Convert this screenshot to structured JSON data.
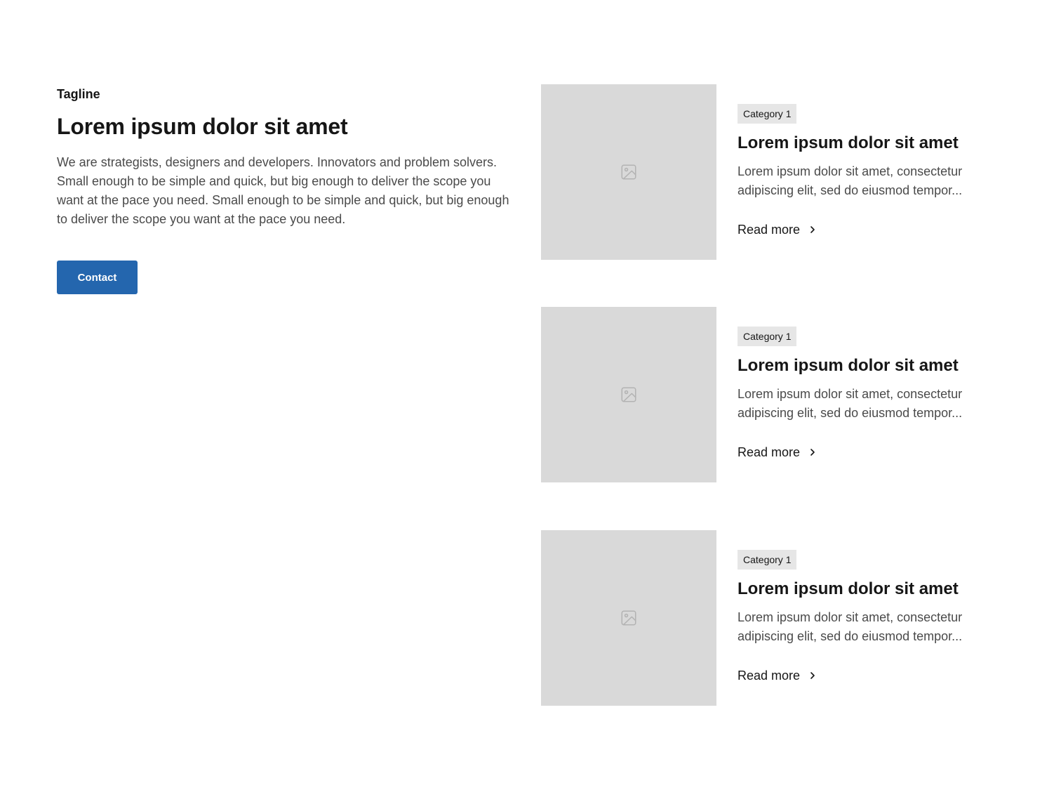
{
  "intro": {
    "tagline": "Tagline",
    "headline": "Lorem ipsum dolor sit amet",
    "description": "We are strategists, designers and developers. Innovators and problem solvers. Small enough to be simple and quick, but big enough to deliver the scope you want at the pace you need. Small enough to be simple and quick, but big enough to deliver the scope you want at the pace you need.",
    "contact_label": "Contact"
  },
  "cards": [
    {
      "category": "Category 1",
      "title": "Lorem ipsum dolor sit amet",
      "excerpt_line1": "Lorem ipsum dolor sit amet, consectetur",
      "excerpt_line2": "adipiscing elit, sed do eiusmod tempor...",
      "read_more": "Read more",
      "image_icon": "image-placeholder-icon"
    },
    {
      "category": "Category 1",
      "title": "Lorem ipsum dolor sit amet",
      "excerpt_line1": "Lorem ipsum dolor sit amet, consectetur",
      "excerpt_line2": "adipiscing elit, sed do eiusmod tempor...",
      "read_more": "Read more",
      "image_icon": "image-placeholder-icon"
    },
    {
      "category": "Category 1",
      "title": "Lorem ipsum dolor sit amet",
      "excerpt_line1": "Lorem ipsum dolor sit amet, consectetur",
      "excerpt_line2": "adipiscing elit, sed do eiusmod tempor...",
      "read_more": "Read more",
      "image_icon": "image-placeholder-icon"
    }
  ],
  "colors": {
    "accent": "#2466ae",
    "placeholder_bg": "#d9d9d9",
    "badge_bg": "#e6e6e6",
    "heading_text": "#161616",
    "body_text": "#4a4a4a"
  }
}
